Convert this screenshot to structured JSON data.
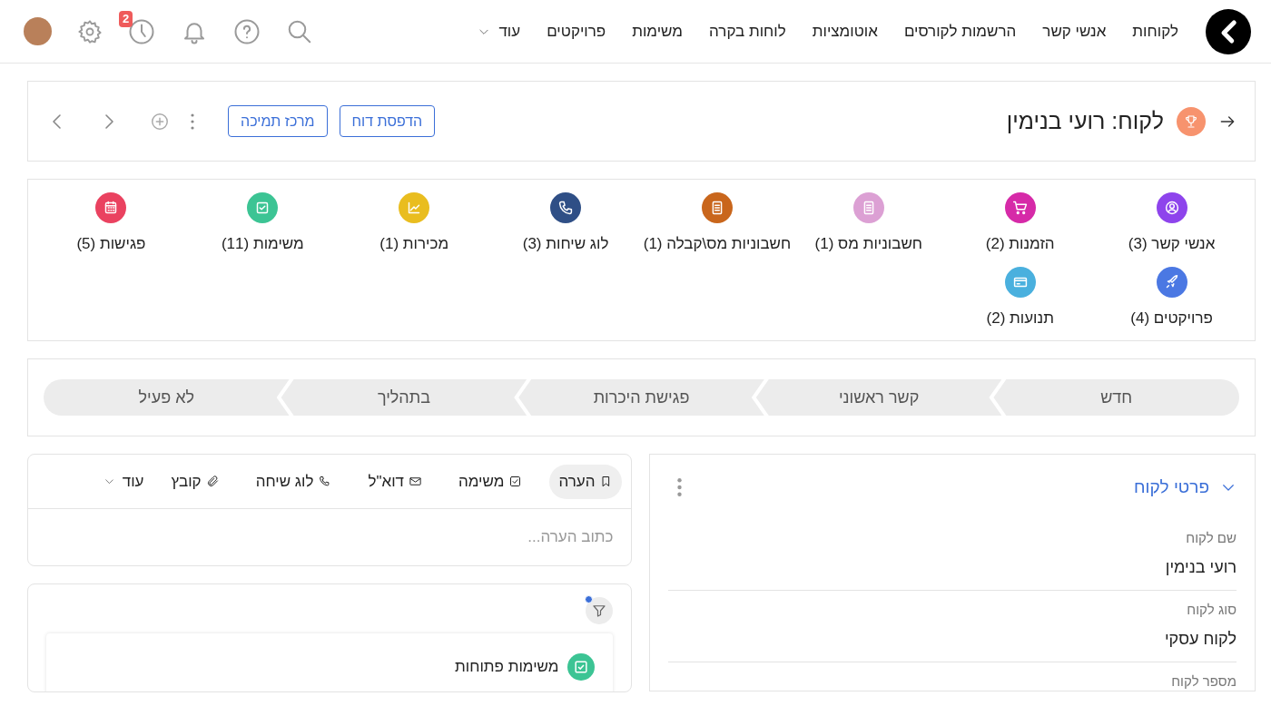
{
  "nav": {
    "items": [
      "לקוחות",
      "אנשי קשר",
      "הרשמות לקורסים",
      "אוטומציות",
      "לוחות בקרה",
      "משימות",
      "פרויקטים"
    ],
    "more": "עוד",
    "history_badge": "2"
  },
  "record": {
    "title": "לקוח: רועי בנימין",
    "buttons": [
      "הדפסת דוח",
      "מרכז תמיכה"
    ]
  },
  "related": [
    {
      "label": "אנשי קשר (3)",
      "color": "#8e44ec"
    },
    {
      "label": "הזמנות (2)",
      "color": "#d62aa8"
    },
    {
      "label": "חשבוניות מס (1)",
      "color": "#dca0d4"
    },
    {
      "label": "חשבוניות מס\\קבלה (1)",
      "color": "#c9661c"
    },
    {
      "label": "לוג שיחות (3)",
      "color": "#2f4f86"
    },
    {
      "label": "מכירות (1)",
      "color": "#e9bd1f"
    },
    {
      "label": "משימות (11)",
      "color": "#3cc494"
    },
    {
      "label": "פגישות (5)",
      "color": "#ea4260"
    },
    {
      "label": "פרויקטים (4)",
      "color": "#4b78e3"
    },
    {
      "label": "תנועות (2)",
      "color": "#4ab0de"
    }
  ],
  "pipeline": [
    "חדש",
    "קשר ראשוני",
    "פגישת היכרות",
    "בתהליך",
    "לא פעיל"
  ],
  "details": {
    "title": "פרטי לקוח",
    "expanded": true,
    "fields": [
      {
        "label": "שם לקוח",
        "value": "רועי בנימין"
      },
      {
        "label": "סוג לקוח",
        "value": "לקוח עסקי"
      },
      {
        "label": "מספר לקוח"
      }
    ]
  },
  "composer": {
    "tabs": [
      {
        "label": "הערה",
        "selected": true
      },
      {
        "label": "משימה",
        "selected": false
      },
      {
        "label": "דוא\"ל",
        "selected": false
      },
      {
        "label": "לוג שיחה",
        "selected": false
      },
      {
        "label": "קובץ",
        "selected": false
      }
    ],
    "more": "עוד",
    "placeholder": "כתוב הערה..."
  },
  "activity": {
    "filter_active": true,
    "section": "משימות פתוחות"
  }
}
